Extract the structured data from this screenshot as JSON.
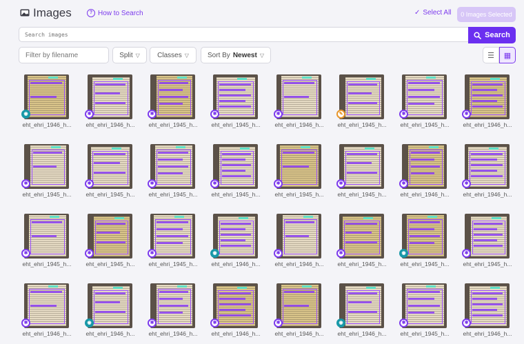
{
  "header": {
    "title": "Images",
    "title_icon": "image-icon",
    "how_to": "How to Search",
    "select_all": "Select All",
    "selected_count": "0 Images Selected"
  },
  "search": {
    "placeholder": "Search images",
    "button_label": "Search"
  },
  "filters": {
    "filename_placeholder": "Filter by filename",
    "split_label": "Split",
    "classes_label": "Classes",
    "sort_prefix": "Sort By",
    "sort_value": "Newest",
    "view_mode": "grid"
  },
  "colors": {
    "accent": "#7c3aed",
    "approved_badge": "#1898a8",
    "edit_badge": "#e8962a"
  },
  "images": [
    {
      "name": "eht_ehri_1946_h...",
      "badge": "approved"
    },
    {
      "name": "eht_ehri_1946_h...",
      "badge": "annotate"
    },
    {
      "name": "eht_ehri_1945_h...",
      "badge": "annotate"
    },
    {
      "name": "eht_ehri_1945_h...",
      "badge": "annotate"
    },
    {
      "name": "eht_ehri_1946_h...",
      "badge": "annotate"
    },
    {
      "name": "eht_ehri_1945_h...",
      "badge": "edit"
    },
    {
      "name": "eht_ehri_1945_h...",
      "badge": "annotate"
    },
    {
      "name": "eht_ehri_1946_h...",
      "badge": "annotate"
    },
    {
      "name": "eht_ehri_1945_h...",
      "badge": "annotate"
    },
    {
      "name": "eht_ehri_1945_h...",
      "badge": "annotate"
    },
    {
      "name": "eht_ehri_1945_h...",
      "badge": "annotate"
    },
    {
      "name": "eht_ehri_1945_h...",
      "badge": "annotate"
    },
    {
      "name": "eht_ehri_1945_h...",
      "badge": "annotate"
    },
    {
      "name": "eht_ehri_1945_h...",
      "badge": "annotate"
    },
    {
      "name": "eht_ehri_1946_h...",
      "badge": "annotate"
    },
    {
      "name": "eht_ehri_1946_h...",
      "badge": "annotate"
    },
    {
      "name": "eht_ehri_1945_h...",
      "badge": "annotate"
    },
    {
      "name": "eht_ehri_1945_h...",
      "badge": "annotate"
    },
    {
      "name": "eht_ehri_1945_h...",
      "badge": "annotate"
    },
    {
      "name": "eht_ehri_1946_h...",
      "badge": "approved"
    },
    {
      "name": "eht_ehri_1946_h...",
      "badge": "annotate"
    },
    {
      "name": "eht_ehri_1945_h...",
      "badge": "annotate"
    },
    {
      "name": "eht_ehri_1945_h...",
      "badge": "approved"
    },
    {
      "name": "eht_ehri_1945_h...",
      "badge": "annotate"
    },
    {
      "name": "eht_ehri_1946_h...",
      "badge": "annotate"
    },
    {
      "name": "eht_ehri_1946_h...",
      "badge": "approved"
    },
    {
      "name": "eht_ehri_1946_h...",
      "badge": "annotate"
    },
    {
      "name": "eht_ehri_1946_h...",
      "badge": "annotate"
    },
    {
      "name": "eht_ehri_1946_h...",
      "badge": "annotate"
    },
    {
      "name": "eht_ehri_1946_h...",
      "badge": "approved"
    },
    {
      "name": "eht_ehri_1945_h...",
      "badge": "annotate"
    },
    {
      "name": "eht_ehri_1946_h...",
      "badge": "annotate"
    }
  ]
}
